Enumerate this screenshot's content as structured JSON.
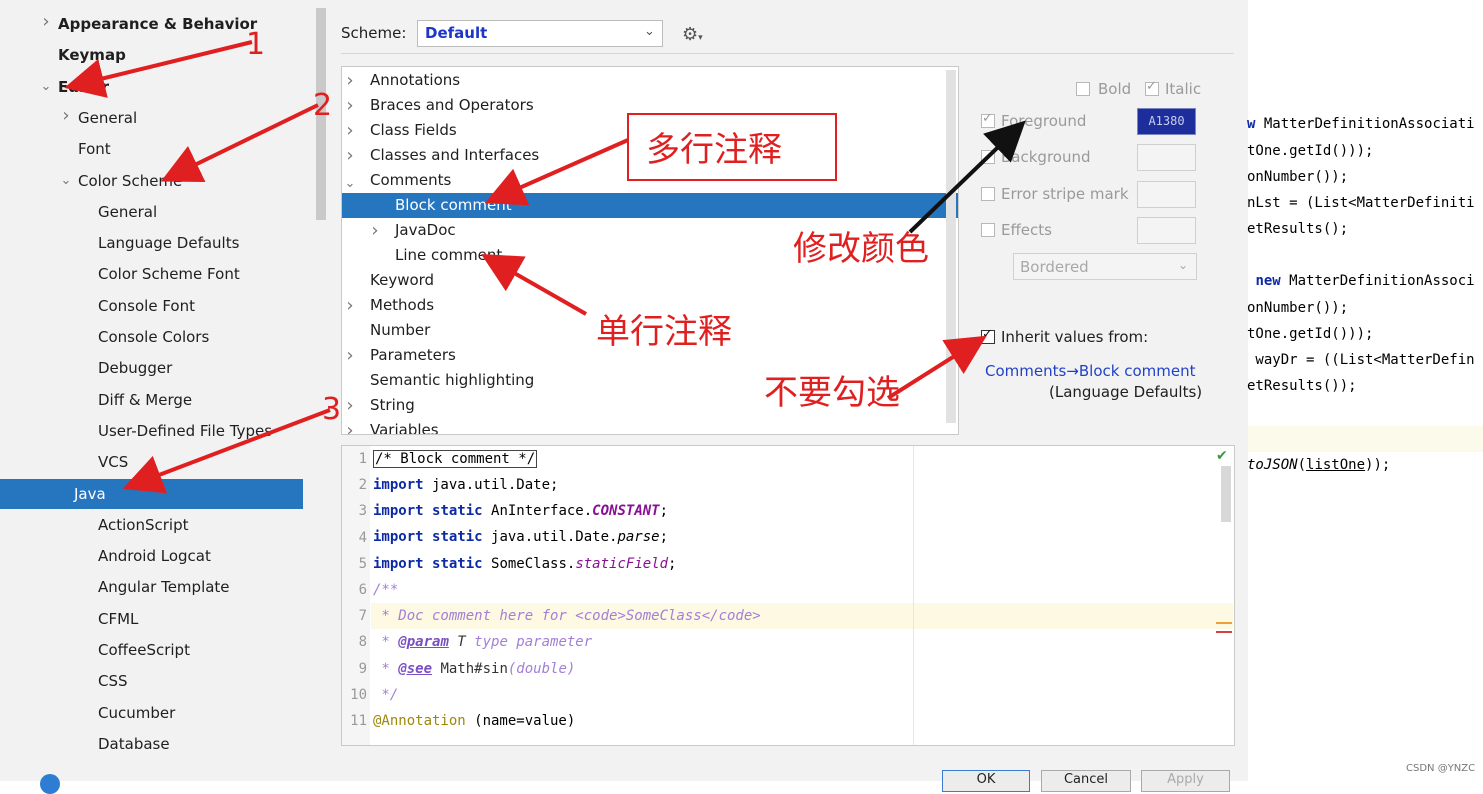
{
  "sidebar": {
    "items": [
      {
        "label": "Appearance & Behavior",
        "bold": true,
        "level": 0,
        "chevron": "right"
      },
      {
        "label": "Keymap",
        "bold": true,
        "level": 0,
        "chevron": "none"
      },
      {
        "label": "Editor",
        "bold": true,
        "level": 0,
        "chevron": "down"
      },
      {
        "label": "General",
        "level": 1,
        "chevron": "right"
      },
      {
        "label": "Font",
        "level": 1,
        "chevron": "none"
      },
      {
        "label": "Color Scheme",
        "level": 1,
        "chevron": "down"
      },
      {
        "label": "General",
        "level": 2
      },
      {
        "label": "Language Defaults",
        "level": 2
      },
      {
        "label": "Color Scheme Font",
        "level": 2
      },
      {
        "label": "Console Font",
        "level": 2
      },
      {
        "label": "Console Colors",
        "level": 2
      },
      {
        "label": "Debugger",
        "level": 2
      },
      {
        "label": "Diff & Merge",
        "level": 2
      },
      {
        "label": "User-Defined File Types",
        "level": 2
      },
      {
        "label": "VCS",
        "level": 2
      },
      {
        "label": "Java",
        "level": 2,
        "selected": true
      },
      {
        "label": "ActionScript",
        "level": 2
      },
      {
        "label": "Android Logcat",
        "level": 2
      },
      {
        "label": "Angular Template",
        "level": 2
      },
      {
        "label": "CFML",
        "level": 2
      },
      {
        "label": "CoffeeScript",
        "level": 2
      },
      {
        "label": "CSS",
        "level": 2
      },
      {
        "label": "Cucumber",
        "level": 2
      },
      {
        "label": "Database",
        "level": 2
      }
    ]
  },
  "scheme": {
    "label": "Scheme:",
    "value": "Default",
    "gear_icon": "gear-icon"
  },
  "categories": [
    {
      "label": "Annotations",
      "indent": 0,
      "chevron": "right"
    },
    {
      "label": "Braces and Operators",
      "indent": 0,
      "chevron": "right"
    },
    {
      "label": "Class Fields",
      "indent": 0,
      "chevron": "right"
    },
    {
      "label": "Classes and Interfaces",
      "indent": 0,
      "chevron": "right"
    },
    {
      "label": "Comments",
      "indent": 0,
      "chevron": "down"
    },
    {
      "label": "Block comment",
      "indent": 1,
      "chevron": "none",
      "selected": true
    },
    {
      "label": "JavaDoc",
      "indent": 1,
      "chevron": "right"
    },
    {
      "label": "Line comment",
      "indent": 1,
      "chevron": "none"
    },
    {
      "label": "Keyword",
      "indent": 0,
      "chevron": "none"
    },
    {
      "label": "Methods",
      "indent": 0,
      "chevron": "right"
    },
    {
      "label": "Number",
      "indent": 0,
      "chevron": "none"
    },
    {
      "label": "Parameters",
      "indent": 0,
      "chevron": "right"
    },
    {
      "label": "Semantic highlighting",
      "indent": 0,
      "chevron": "none"
    },
    {
      "label": "String",
      "indent": 0,
      "chevron": "right"
    },
    {
      "label": "Variables",
      "indent": 0,
      "chevron": "right"
    }
  ],
  "attributes": {
    "bold": "Bold",
    "italic": "Italic",
    "foreground": "Foreground",
    "foreground_value": "A1380",
    "foreground_color": "#1d2e9c",
    "background": "Background",
    "error_stripe": "Error stripe mark",
    "effects": "Effects",
    "effects_type": "Bordered",
    "inherit_label": "Inherit values from:",
    "inherit_link": "Comments→Block comment",
    "inherit_note": "(Language Defaults)"
  },
  "preview": {
    "line_numbers": [
      "1",
      "2",
      "3",
      "4",
      "5",
      "6",
      "7",
      "8",
      "9",
      "10",
      "11"
    ],
    "line1": "/* Block comment */",
    "import_kw": "import",
    "static_kw": "static",
    "l2_rest": " java.util.Date;",
    "l3_mid": " AnInterface.",
    "l3_const": "CONSTANT",
    "l4_mid": " java.util.Date.",
    "l4_method": "parse",
    "l5_mid": " SomeClass.",
    "l5_field": "staticField",
    "semicolon": ";",
    "l6": "/**",
    "l7": " * Doc comment here for <code>SomeClass</code>",
    "l8_star": " * ",
    "l8_tag": "@param",
    "l8_T": " T",
    "l8_rest": " type parameter",
    "l9_tag": "@see",
    "l9_ref": " Math#sin",
    "l9_rest": "(double)",
    "l10": " */",
    "l11_anno": "@Annotation",
    "l11_rest": " (name=value)"
  },
  "buttons": {
    "ok": "OK",
    "cancel": "Cancel",
    "apply": "Apply"
  },
  "background_editor": {
    "lines": [
      "w MatterDefinitionAssociati",
      "tOne.getId()));",
      "onNumber());",
      "nLst = (List<MatterDefiniti",
      "etResults();",
      " new MatterDefinitionAssoci",
      "onNumber());",
      "tOne.getId()));",
      " wayDr = ((List<MatterDefin",
      "etResults());",
      "toJSON(listOne));"
    ],
    "watermark": "CSDN @YNZC"
  },
  "annotations": {
    "n1": "1",
    "n2": "2",
    "n3": "3",
    "multi_line": "多行注释",
    "single_line": "单行注释",
    "modify_color": "修改颜色",
    "dont_check": "不要勾选"
  }
}
